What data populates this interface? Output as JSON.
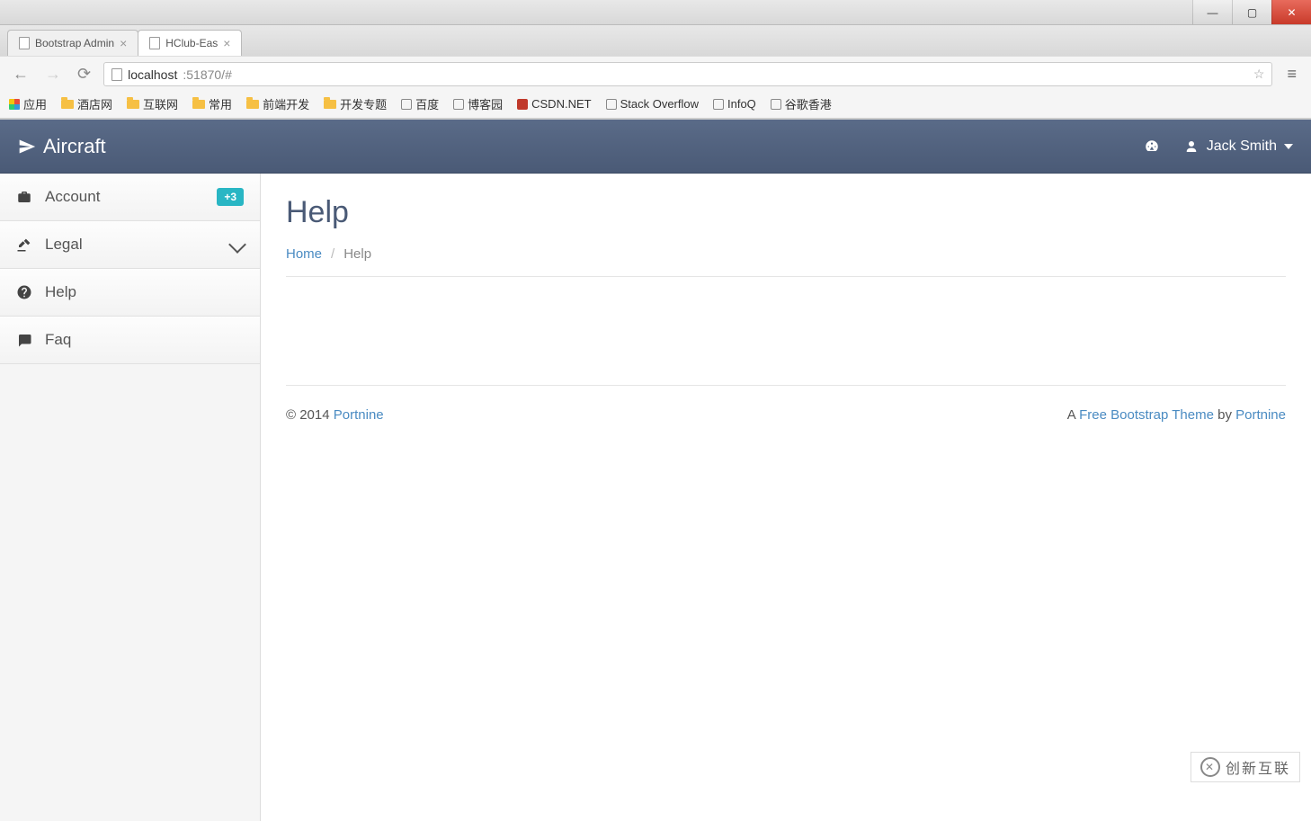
{
  "browser": {
    "tabs": [
      {
        "title": "Bootstrap Admin"
      },
      {
        "title": "HClub-Eas"
      }
    ],
    "url_host": "localhost",
    "url_port_path": ":51870/#",
    "bookmarks": [
      {
        "label": "应用",
        "icon": "apps"
      },
      {
        "label": "酒店网",
        "icon": "folder"
      },
      {
        "label": "互联网",
        "icon": "folder"
      },
      {
        "label": "常用",
        "icon": "folder"
      },
      {
        "label": "前端开发",
        "icon": "folder"
      },
      {
        "label": "开发专题",
        "icon": "folder"
      },
      {
        "label": "百度",
        "icon": "site"
      },
      {
        "label": "博客园",
        "icon": "site"
      },
      {
        "label": "CSDN.NET",
        "icon": "site"
      },
      {
        "label": "Stack Overflow",
        "icon": "site"
      },
      {
        "label": "InfoQ",
        "icon": "site"
      },
      {
        "label": "谷歌香港",
        "icon": "site"
      }
    ]
  },
  "navbar": {
    "brand": "Aircraft",
    "user": "Jack Smith"
  },
  "sidebar": {
    "items": [
      {
        "label": "Account",
        "icon": "briefcase",
        "badge": "+3"
      },
      {
        "label": "Legal",
        "icon": "gavel",
        "expandable": true
      },
      {
        "label": "Help",
        "icon": "help"
      },
      {
        "label": "Faq",
        "icon": "comment"
      }
    ]
  },
  "page": {
    "title": "Help",
    "breadcrumb": {
      "home": "Home",
      "current": "Help"
    }
  },
  "footer": {
    "copyright": "© 2014 ",
    "copyright_link": "Portnine",
    "right_prefix": "A ",
    "theme_link": "Free Bootstrap Theme",
    "right_mid": " by ",
    "by_link": "Portnine"
  },
  "watermark": "创新互联"
}
